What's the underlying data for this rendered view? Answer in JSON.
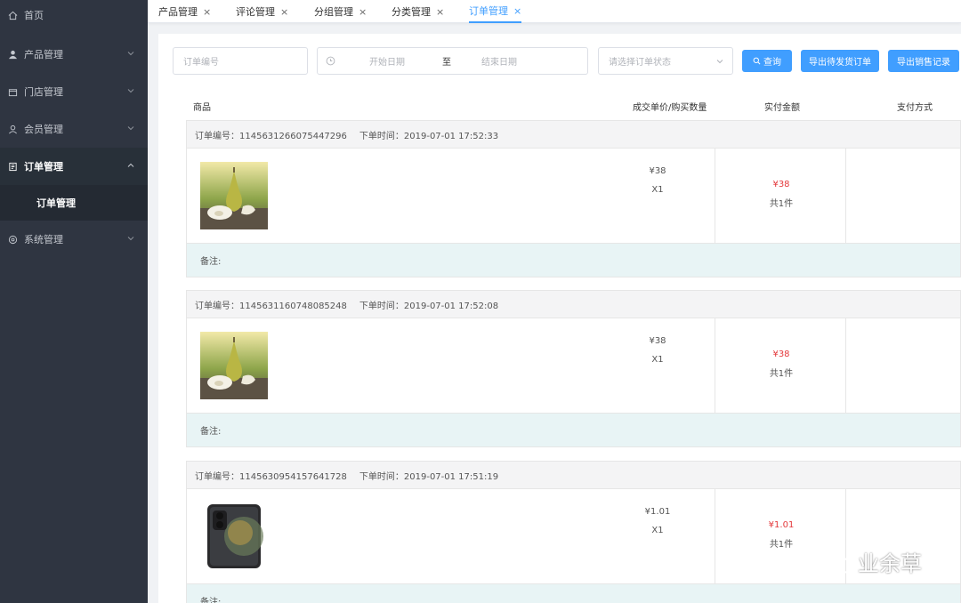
{
  "sidebar": {
    "items": [
      {
        "label": "首页",
        "icon": "home-icon"
      },
      {
        "label": "产品管理",
        "icon": "user-icon"
      },
      {
        "label": "门店管理",
        "icon": "store-icon"
      },
      {
        "label": "会员管理",
        "icon": "member-icon"
      },
      {
        "label": "订单管理",
        "icon": "order-icon"
      },
      {
        "label": "系统管理",
        "icon": "gear-icon"
      }
    ],
    "sub_item": "订单管理"
  },
  "tabs": [
    {
      "label": "产品管理",
      "close": "×"
    },
    {
      "label": "评论管理",
      "close": "×"
    },
    {
      "label": "分组管理",
      "close": "×"
    },
    {
      "label": "分类管理",
      "close": "×"
    },
    {
      "label": "订单管理",
      "close": "×"
    }
  ],
  "filters": {
    "order_no_placeholder": "订单编号",
    "start_date_placeholder": "开始日期",
    "range_separator": "至",
    "end_date_placeholder": "结束日期",
    "status_placeholder": "请选择订单状态"
  },
  "buttons": {
    "query": "查询",
    "export_pending": "导出待发货订单",
    "export_sales": "导出销售记录"
  },
  "table_headers": {
    "product": "商品",
    "price_qty": "成交单价/购买数量",
    "paid": "实付金额",
    "pay_method": "支付方式"
  },
  "orders": [
    {
      "no_label": "订单编号：1145631266075447296",
      "time_label": "下单时间：2019-07-01 17:52:33",
      "product_image": "pear-image",
      "unit_price": "¥38",
      "qty": "X1",
      "paid": "¥38",
      "count": "共1件",
      "note": "备注:"
    },
    {
      "no_label": "订单编号：1145631160748085248",
      "time_label": "下单时间：2019-07-01 17:52:08",
      "product_image": "pear-image",
      "unit_price": "¥38",
      "qty": "X1",
      "paid": "¥38",
      "count": "共1件",
      "note": "备注:"
    },
    {
      "no_label": "订单编号：1145630954157641728",
      "time_label": "下单时间：2019-07-01 17:51:19",
      "product_image": "phone-image",
      "unit_price": "¥1.01",
      "qty": "X1",
      "paid": "¥1.01",
      "count": "共1件",
      "note": "备注:"
    }
  ],
  "watermark": "业余草",
  "colors": {
    "sidebar_bg": "#2f3541",
    "accent": "#409eff",
    "price_red": "#e4393c",
    "note_bg": "#e8f4f5"
  }
}
